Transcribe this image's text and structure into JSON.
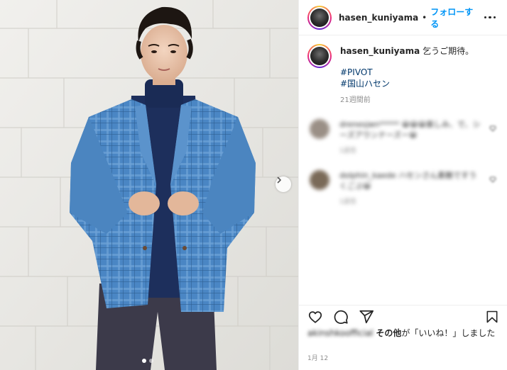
{
  "post": {
    "username": "hasen_kuniyama",
    "separator": "•",
    "follow_label": "フォローする",
    "caption": "乞うご期待。",
    "hashtags": [
      "#PIVOT",
      "#国山ハセン"
    ],
    "time_ago": "21週間前"
  },
  "comments": [
    {
      "text": "drenesjwn***** 😀😀😀楽しみ、で、シーズアウンナーズー😀",
      "meta": "1返信",
      "avatar_color": "#9a8f86"
    },
    {
      "text": "dolphin_kaede ハセンさん素敵ですうくごぶ😀",
      "meta": "1返信",
      "avatar_color": "#7a6a58"
    }
  ],
  "engagement": {
    "liked_by": "akinshkoofficial",
    "likes_others": "その他",
    "likes_suffix": "が「いいね！」しました",
    "date": "1月 12"
  },
  "icons": {
    "more": "more-options-icon",
    "next": "chevron-right-icon",
    "like": "heart-icon",
    "comment": "comment-icon",
    "share": "paper-plane-icon",
    "save": "bookmark-icon"
  },
  "colors": {
    "accent": "#0095f6",
    "hashtag": "#00376b",
    "muted": "#8e8e8e",
    "text": "#262626"
  },
  "carousel": {
    "slide_count": 2,
    "active_slide": 1
  }
}
